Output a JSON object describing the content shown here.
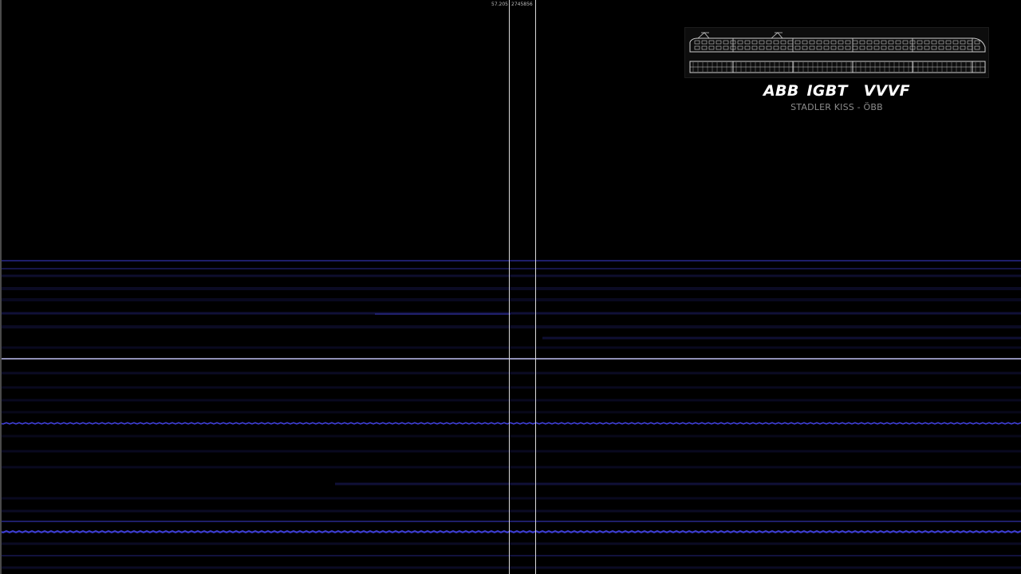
{
  "readout": {
    "time": "57.205",
    "samples": "2745856"
  },
  "title": {
    "main": "ABB IGBT  VVVF",
    "subtitle": "STADLER KISS - ÖBB"
  },
  "colors": {
    "background": "#000000",
    "spectrum_line": "#4b4bff",
    "spectrum_bright": "#c9c9ff",
    "cursor": "#d9d9d9",
    "title": "#ffffff",
    "subtitle": "#8c8c8c"
  },
  "icons": {
    "train_diagram": "double-deck-train-diagram-icon"
  }
}
